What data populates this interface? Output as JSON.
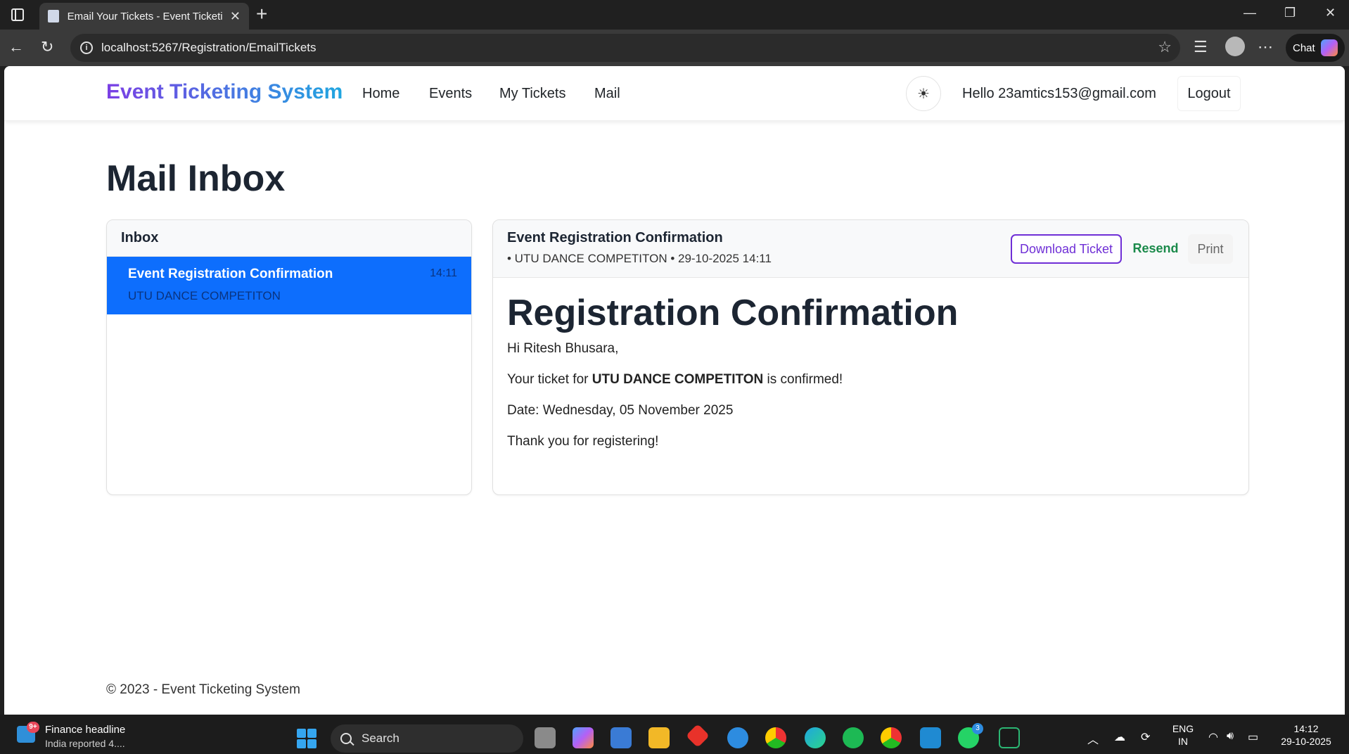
{
  "browser": {
    "tab_title": "Email Your Tickets - Event Ticketin",
    "url": "localhost:5267/Registration/EmailTickets",
    "chat_label": "Chat"
  },
  "navbar": {
    "brand": "Event Ticketing System",
    "links": [
      "Home",
      "Events",
      "My Tickets",
      "Mail"
    ],
    "theme_icon": "☀",
    "greeting": "Hello 23amtics153@gmail.com",
    "logout": "Logout"
  },
  "page": {
    "title": "Mail Inbox"
  },
  "inbox": {
    "header": "Inbox",
    "items": [
      {
        "subject": "Event Registration Confirmation",
        "event": "UTU DANCE COMPETITON",
        "time": "14:11"
      }
    ]
  },
  "message": {
    "subject": "Event Registration Confirmation",
    "meta": "• UTU DANCE COMPETITON • 29-10-2025 14:11",
    "actions": {
      "download": "Download Ticket",
      "resend": "Resend",
      "print": "Print"
    },
    "body": {
      "heading": "Registration Confirmation",
      "greeting": "Hi Ritesh Bhusara,",
      "line_prefix": "Your ticket for ",
      "event_name": "UTU DANCE COMPETITON",
      "line_suffix": " is confirmed!",
      "date_line": "Date: Wednesday, 05 November 2025",
      "thanks": "Thank you for registering!"
    }
  },
  "footer": {
    "text": "© 2023 - Event Ticketing System"
  },
  "taskbar": {
    "news_title": "Finance headline",
    "news_sub": "India reported 4....",
    "news_badge": "9+",
    "search": "Search",
    "lang_top": "ENG",
    "lang_bottom": "IN",
    "time": "14:12",
    "date": "29-10-2025",
    "whatsapp_badge": "3"
  },
  "colors": {
    "primary": "#0d6efd",
    "brand_start": "#7b3fe4",
    "brand_end": "#1fa6e0",
    "download_accent": "#6f2fd6",
    "resend_accent": "#1a8a4a"
  }
}
